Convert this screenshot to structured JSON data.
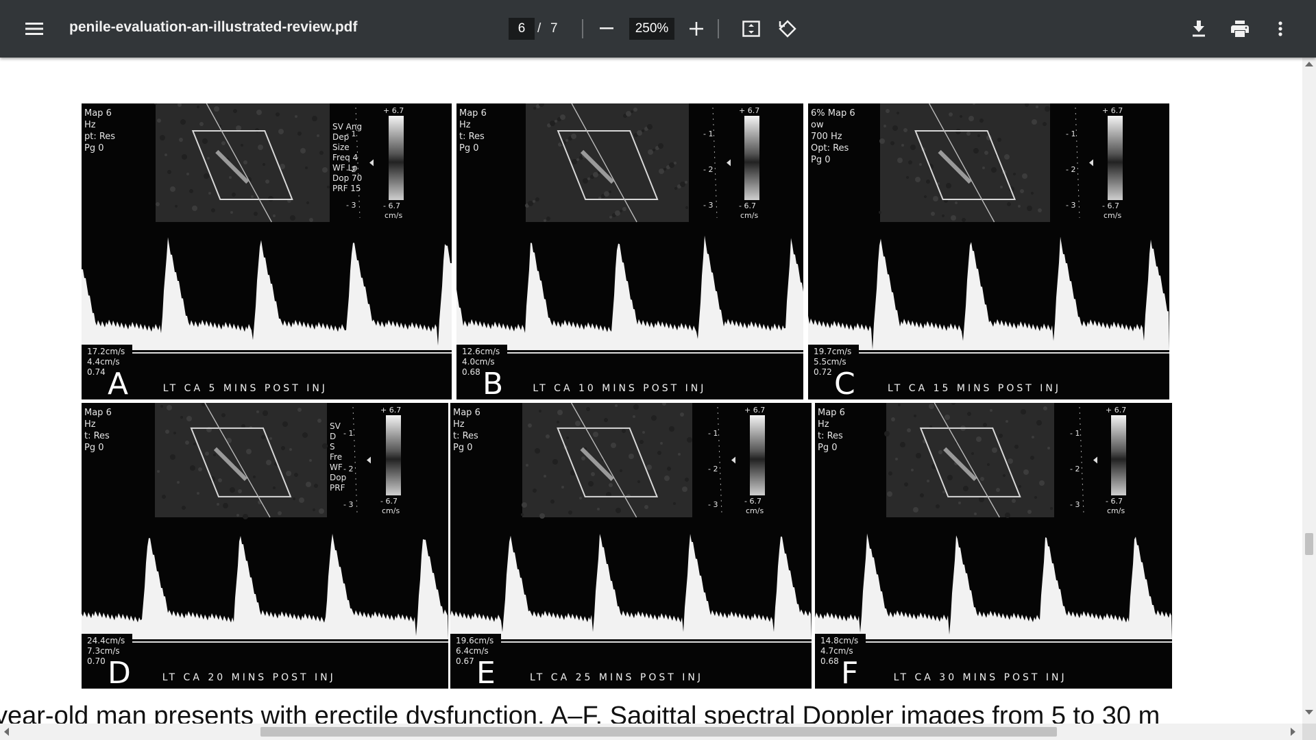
{
  "toolbar": {
    "title": "penile-evaluation-an-illustrated-review.pdf",
    "current_page": "6",
    "page_separator": "/",
    "total_pages": "7",
    "zoom": "250%"
  },
  "panels": [
    {
      "letter": "A",
      "footer": "LT CA 5 MINS POST INJ",
      "settings": [
        "Map 6",
        "Hz",
        "pt: Res",
        "Pg 0"
      ],
      "side_text": [
        "SV Ang",
        "Dep",
        "Size",
        "Freq 4",
        "WF Lo",
        "Dop 70",
        "PRF 15"
      ],
      "scale_top": "+ 6.7",
      "scale_bottom": "- 6.7",
      "scale_unit": "cm/s",
      "depth_marks": [
        "1",
        "2",
        "3"
      ],
      "measurements": [
        "17.2cm/s",
        "4.4cm/s",
        "0.74"
      ]
    },
    {
      "letter": "B",
      "footer": "LT CA 10 MINS POST INJ",
      "settings": [
        "Map 6",
        "Hz",
        "t: Res",
        "Pg 0"
      ],
      "side_text": [],
      "scale_top": "+ 6.7",
      "scale_bottom": "- 6.7",
      "scale_unit": "cm/s",
      "depth_marks": [
        "1",
        "2",
        "3"
      ],
      "measurements": [
        "12.6cm/s",
        "4.0cm/s",
        "0.68"
      ]
    },
    {
      "letter": "C",
      "footer": "LT CA 15 MINS POST INJ",
      "settings": [
        "6% Map 6",
        "ow",
        "700 Hz",
        "Opt: Res",
        "Pg 0"
      ],
      "side_text": [],
      "scale_top": "+ 6.7",
      "scale_bottom": "- 6.7",
      "scale_unit": "cm/s",
      "depth_marks": [
        "1",
        "2",
        "3"
      ],
      "measurements": [
        "19.7cm/s",
        "5.5cm/s",
        "0.72"
      ]
    },
    {
      "letter": "D",
      "footer": "LT CA 20 MINS POST INJ",
      "settings": [
        "Map 6",
        "Hz",
        "t: Res",
        "Pg 0"
      ],
      "side_text": [
        "SV",
        "D",
        "S",
        "Fre",
        "WF",
        "Dop",
        "PRF"
      ],
      "scale_top": "+ 6.7",
      "scale_bottom": "- 6.7",
      "scale_unit": "cm/s",
      "depth_marks": [
        "1",
        "2",
        "3"
      ],
      "measurements": [
        "24.4cm/s",
        "7.3cm/s",
        "0.70"
      ]
    },
    {
      "letter": "E",
      "footer": "LT CA 25 MINS POST INJ",
      "settings": [
        "Map 6",
        "Hz",
        "t: Res",
        "Pg 0"
      ],
      "side_text": [],
      "scale_top": "+ 6.7",
      "scale_bottom": "- 6.7",
      "scale_unit": "cm/s",
      "depth_marks": [
        "1",
        "2",
        "3"
      ],
      "measurements": [
        "19.6cm/s",
        "6.4cm/s",
        "0.67"
      ]
    },
    {
      "letter": "F",
      "footer": "LT CA 30 MINS POST INJ",
      "settings": [
        "Map 6",
        "Hz",
        "t: Res",
        "Pg 0"
      ],
      "side_text": [],
      "scale_top": "+ 6.7",
      "scale_bottom": "- 6.7",
      "scale_unit": "cm/s",
      "depth_marks": [
        "1",
        "2",
        "3"
      ],
      "measurements": [
        "14.8cm/s",
        "4.7cm/s",
        "0.68"
      ]
    }
  ],
  "caption": "year-old man presents with erectile dysfunction. A–F, Sagittal spectral Doppler images from 5 to 30 m"
}
